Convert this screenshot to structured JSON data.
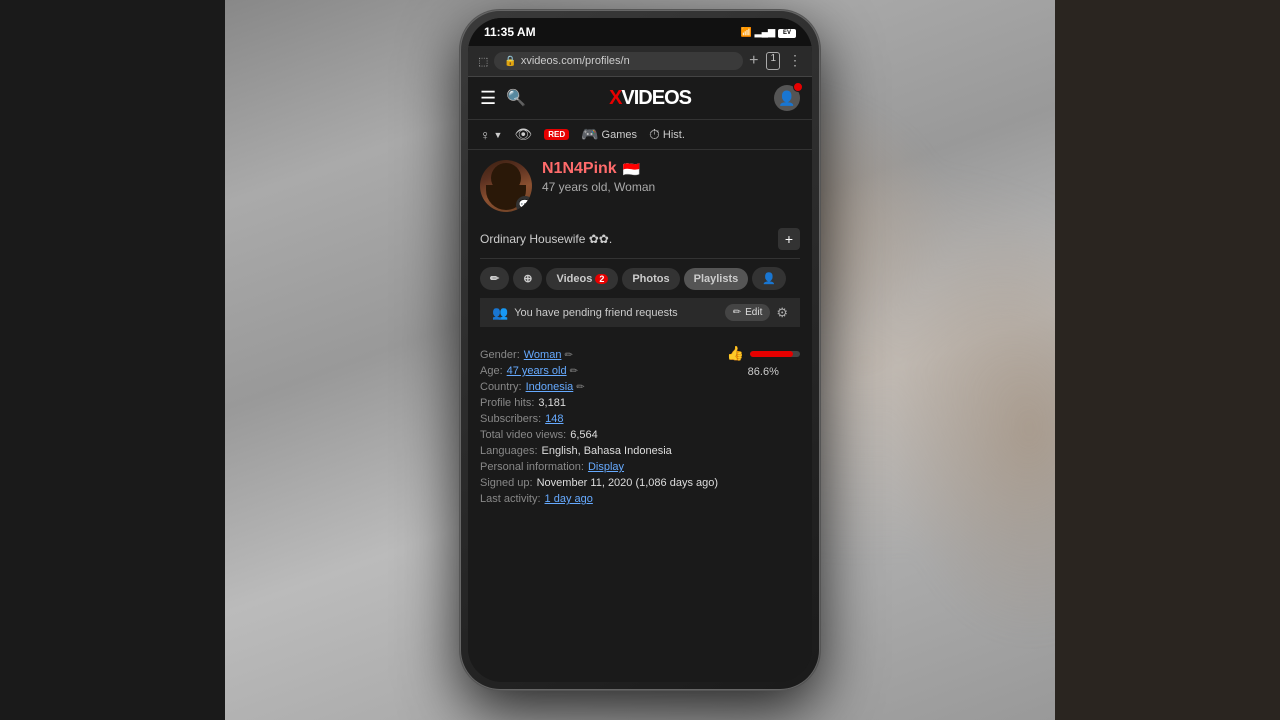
{
  "scene": {
    "bg_colors": {
      "left": "#1a1a1a",
      "right": "#2a2520",
      "center": "#888"
    }
  },
  "phone": {
    "status_bar": {
      "time": "11:35 AM",
      "battery_text": "EV"
    },
    "browser": {
      "url": "xvideos.com/profiles/n",
      "plus_label": "+",
      "tabs_label": "1",
      "menu_label": "⋮"
    },
    "navbar": {
      "logo_x": "X",
      "logo_videos": "VIDEOS",
      "hamburger": "☰",
      "search": "🔍"
    },
    "sub_navbar": {
      "gender_icon": "♀",
      "gender_label": "",
      "cam_icon": "👁",
      "red_label": "RED",
      "games_icon": "🎮",
      "games_label": "Games",
      "hist_icon": "⏱",
      "hist_label": "Hist."
    },
    "profile": {
      "name": "N1N4Pink",
      "age_gender": "47 years old, Woman",
      "bio": "Ordinary Housewife ✿✿.",
      "tabs": [
        {
          "label": "✏",
          "type": "icon"
        },
        {
          "label": "RSS",
          "type": "icon"
        },
        {
          "label": "Videos",
          "count": "2"
        },
        {
          "label": "Photos",
          "count": ""
        },
        {
          "label": "Playlists",
          "count": ""
        },
        {
          "label": "⊕",
          "count": ""
        }
      ],
      "pending_text": "You have pending friend requests",
      "edit_label": "Edit",
      "stats": [
        {
          "label": "Gender:",
          "value": "Woman",
          "link": true,
          "extra": "✏"
        },
        {
          "label": "Age:",
          "value": "47 years old",
          "link": true,
          "extra": "✏"
        },
        {
          "label": "Country:",
          "value": "Indonesia",
          "link": true,
          "extra": "✏"
        },
        {
          "label": "Profile hits:",
          "value": "3,181",
          "link": false
        },
        {
          "label": "Subscribers:",
          "value": "148",
          "link": true
        },
        {
          "label": "Total video views:",
          "value": "6,564",
          "link": false
        },
        {
          "label": "Languages:",
          "value": "English, Bahasa Indonesia",
          "link": false
        },
        {
          "label": "Personal information:",
          "value": "Display",
          "link": true
        },
        {
          "label": "Signed up:",
          "value": "November 11, 2020 (1,086 days ago)",
          "link": false
        },
        {
          "label": "Last activity:",
          "value": "1 day ago",
          "link": true
        }
      ],
      "rating": {
        "percent": "86.6%",
        "fill_width": 86.6
      }
    }
  }
}
